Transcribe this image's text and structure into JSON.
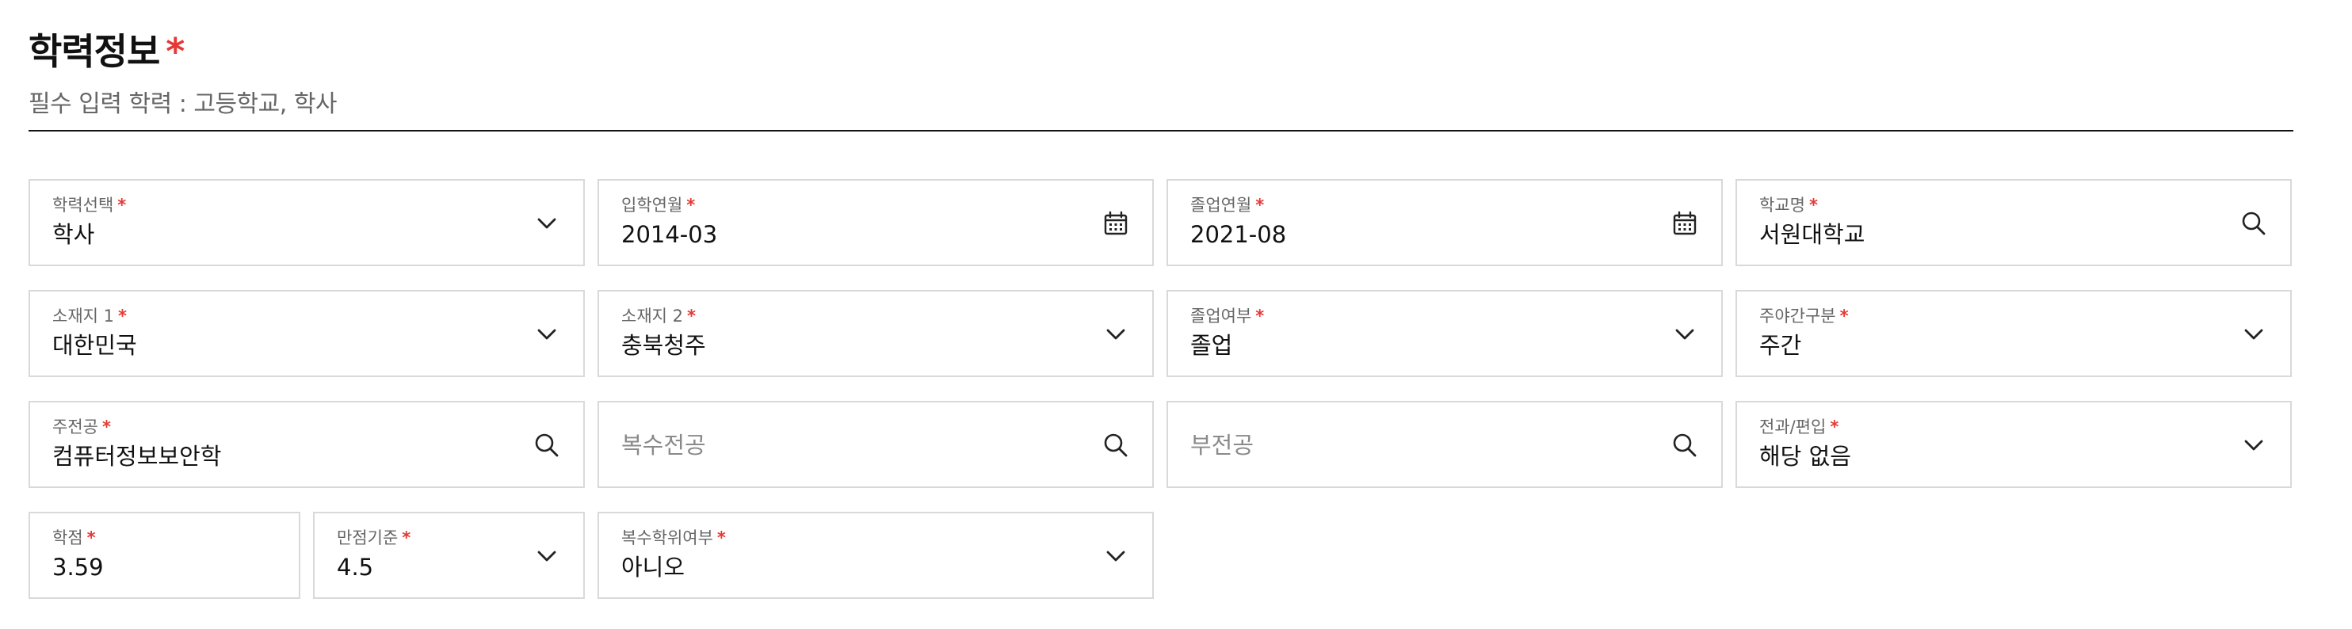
{
  "section": {
    "title": "학력정보",
    "required_mark": "*",
    "subtitle": "필수 입력 학력 : 고등학교, 학사"
  },
  "fields": {
    "education_level": {
      "label": "학력선택",
      "required": "*",
      "value": "학사",
      "icon": "chevron-down-icon"
    },
    "admission_date": {
      "label": "입학연월",
      "required": "*",
      "value": "2014-03",
      "icon": "calendar-icon"
    },
    "graduation_date": {
      "label": "졸업연월",
      "required": "*",
      "value": "2021-08",
      "icon": "calendar-icon"
    },
    "school_name": {
      "label": "학교명",
      "required": "*",
      "value": "서원대학교",
      "icon": "search-icon"
    },
    "location1": {
      "label": "소재지 1",
      "required": "*",
      "value": "대한민국",
      "icon": "chevron-down-icon"
    },
    "location2": {
      "label": "소재지 2",
      "required": "*",
      "value": "충북청주",
      "icon": "chevron-down-icon"
    },
    "graduation_status": {
      "label": "졸업여부",
      "required": "*",
      "value": "졸업",
      "icon": "chevron-down-icon"
    },
    "day_night": {
      "label": "주야간구분",
      "required": "*",
      "value": "주간",
      "icon": "chevron-down-icon"
    },
    "major": {
      "label": "주전공",
      "required": "*",
      "value": "컴퓨터정보보안학",
      "icon": "search-icon"
    },
    "double_major": {
      "placeholder": "복수전공",
      "icon": "search-icon"
    },
    "minor": {
      "placeholder": "부전공",
      "icon": "search-icon"
    },
    "transfer": {
      "label": "전과/편입",
      "required": "*",
      "value": "해당 없음",
      "icon": "chevron-down-icon"
    },
    "gpa": {
      "label": "학점",
      "required": "*",
      "value": "3.59"
    },
    "gpa_scale": {
      "label": "만점기준",
      "required": "*",
      "value": "4.5",
      "icon": "chevron-down-icon"
    },
    "double_degree": {
      "label": "복수학위여부",
      "required": "*",
      "value": "아니오",
      "icon": "chevron-down-icon"
    }
  }
}
